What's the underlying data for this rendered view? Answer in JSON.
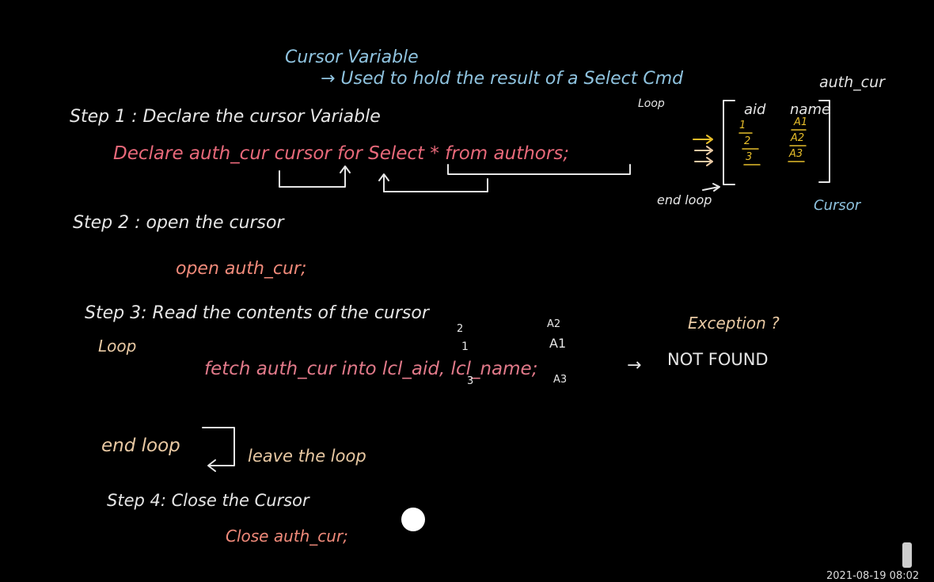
{
  "title": "Cursor Variable",
  "definition": "→ Used to hold the result of a Select Cmd",
  "step1": {
    "heading": "Step 1 :  Declare the cursor Variable",
    "code": "Declare auth_cur cursor for Select * from authors;"
  },
  "step2": {
    "heading": "Step 2 :  open the cursor",
    "code": "open auth_cur;"
  },
  "step3": {
    "heading": "Step 3:  Read the contents of the cursor",
    "loop_label": "Loop",
    "code": "fetch auth_cur into lcl_aid, lcl_name;",
    "arrow": "→",
    "not_found": "NOT FOUND",
    "exception": "Exception ?",
    "aid_values": [
      "2",
      "1",
      "3"
    ],
    "name_values": [
      "A2",
      "A1",
      "A3"
    ]
  },
  "end_loop": {
    "label": "end loop",
    "note": "leave the loop"
  },
  "step4": {
    "heading": "Step 4:  Close the Cursor",
    "code": "Close auth_cur;"
  },
  "diagram": {
    "title": "auth_cur",
    "loop_label": "Loop",
    "end_loop_label": "end loop",
    "caption": "Cursor",
    "columns": [
      "aid",
      "name"
    ],
    "rows": [
      {
        "aid": "1",
        "name": "A1"
      },
      {
        "aid": "2",
        "name": "A2"
      },
      {
        "aid": "3",
        "name": "A3"
      }
    ]
  },
  "timestamp": "2021-08-19 08:02"
}
